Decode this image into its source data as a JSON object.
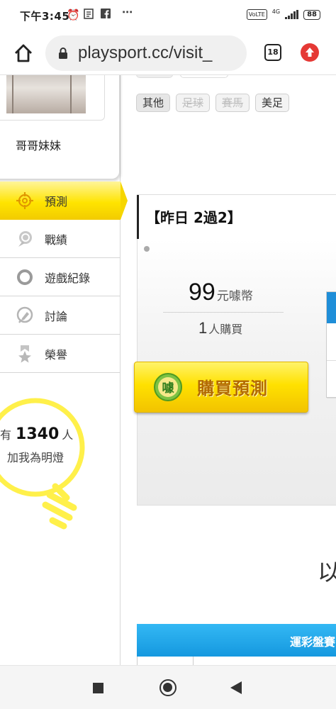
{
  "status_bar": {
    "time": "下午3:45",
    "network": "4G",
    "volte": "VoLTE",
    "battery": "88"
  },
  "browser": {
    "url": "playsport.cc/visit_",
    "tab_count": "18"
  },
  "sidebar": {
    "profile_name": "哥哥妹妹",
    "menu": [
      {
        "label": "預測",
        "icon": "target-icon",
        "active": true
      },
      {
        "label": "戰績",
        "icon": "medal-icon",
        "active": false
      },
      {
        "label": "遊戲紀錄",
        "icon": "ring-icon",
        "active": false
      },
      {
        "label": "討論",
        "icon": "chat-pencil-icon",
        "active": false
      },
      {
        "label": "榮譽",
        "icon": "award-ribbon-icon",
        "active": false
      }
    ],
    "fans": {
      "prefix": "有",
      "count": "1340",
      "suffix": "人",
      "line2": "加我為明燈"
    }
  },
  "main": {
    "tags": [
      {
        "label": "其他",
        "state": "active"
      },
      {
        "label": "足球",
        "state": "disabled"
      },
      {
        "label": "賽馬",
        "state": "disabled"
      },
      {
        "label": "美足",
        "state": "normal"
      }
    ],
    "prediction": {
      "title": "【昨日 2過2】",
      "price": "99",
      "price_unit": "元噱幣",
      "buyers": "1",
      "buyers_unit": "人購買",
      "buy_button": "購買預測",
      "buy_icon_char": "噱"
    },
    "partial_text": "以",
    "lottery_bar": "運彩盤賽"
  },
  "colors": {
    "accent_yellow": "#ffe100",
    "accent_blue": "#1598df",
    "update_red": "#e53935"
  }
}
